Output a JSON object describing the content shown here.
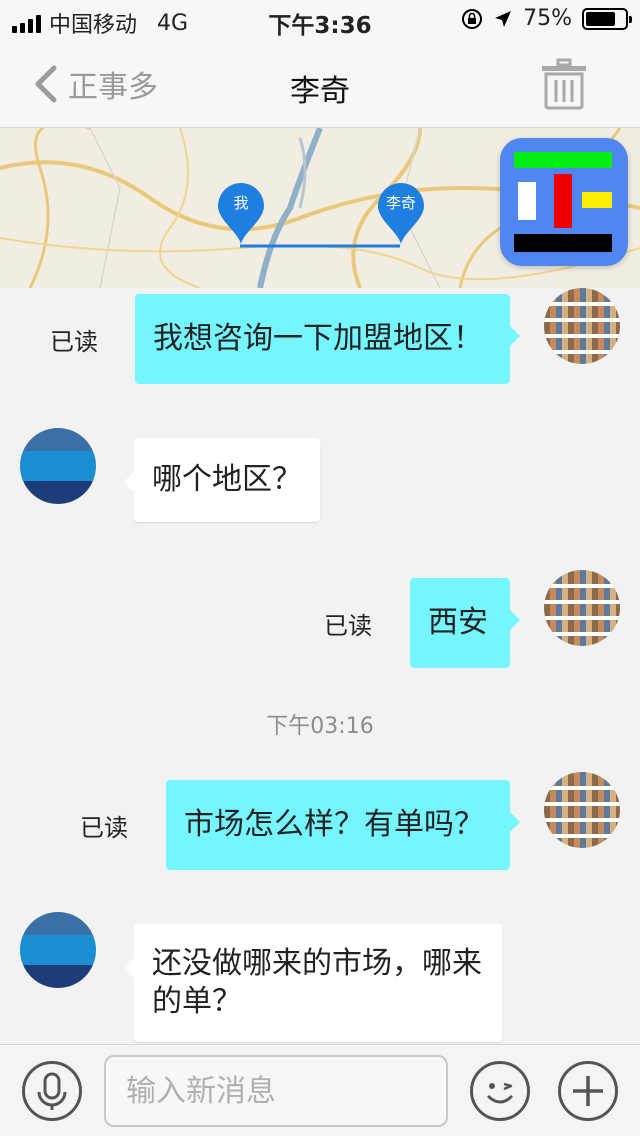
{
  "status_bar": {
    "carrier": "中国移动",
    "network": "4G",
    "time": "下午3:36",
    "battery": "75%",
    "battery_level": 0.75
  },
  "nav": {
    "back_label": "正事多",
    "title": "李奇"
  },
  "map": {
    "pin_me": "我",
    "pin_other": "李奇"
  },
  "messages": [
    {
      "direction": "out",
      "text": "我想咨询一下加盟地区！",
      "status": "已读"
    },
    {
      "direction": "in",
      "text": "哪个地区？"
    },
    {
      "direction": "out",
      "text": "西安",
      "status": "已读"
    },
    {
      "timestamp": "下午03:16"
    },
    {
      "direction": "out",
      "text": "市场怎么样？有单吗？",
      "status": "已读"
    },
    {
      "direction": "in",
      "text": "还没做哪来的市场，哪来的单？"
    }
  ],
  "input": {
    "placeholder": "输入新消息"
  },
  "colors": {
    "outgoing_bubble": "#75f6ff",
    "incoming_bubble": "#ffffff",
    "map_pin": "#1f7fe0"
  }
}
